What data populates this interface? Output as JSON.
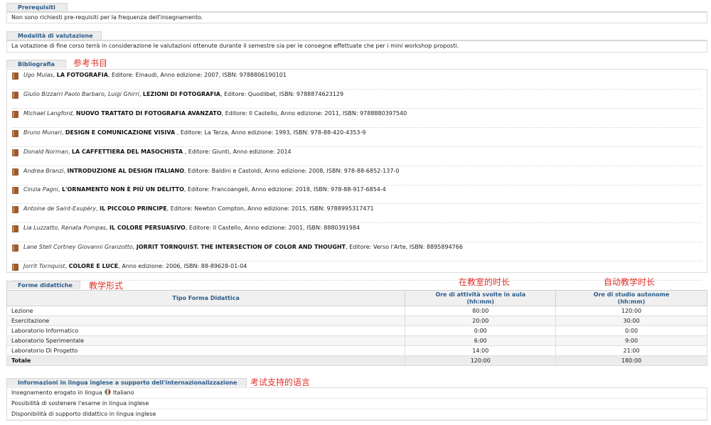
{
  "prerequisiti": {
    "tab_label": "Prerequisiti",
    "text": "Non sono richiesti pre-requisiti per la frequenza dell'insegnamento."
  },
  "valutazione": {
    "tab_label": "Modalità di valutazione",
    "text": "La votazione di fine corso terrà in considerazione le valutazioni ottenute durante il semestre sia per le consegne effettuate che per i mini workshop proposti."
  },
  "bibliografia": {
    "tab_label": "Bibliografia",
    "annotation": "参考书目",
    "items": [
      {
        "authors": "Ugo Mulas",
        "title": "LA FOTOGRAFIA",
        "details": ", Editore: Einaudi, Anno edizione: 2007, ISBN: 9788806190101"
      },
      {
        "authors": "Giulio Bizzarri Paolo Barbaro, Luigi Ghirri",
        "title": "LEZIONI DI FOTOGRAFIA",
        "details": ", Editore: Quodlibet, ISBN: 9788874623129"
      },
      {
        "authors": "Michael Langford",
        "title": "NUOVO TRATTATO DI FOTOGRAFIA AVANZATO",
        "details": ", Editore: Il Castello, Anno edizione: 2011, ISBN: 9788880397540"
      },
      {
        "authors": "Bruno Munari",
        "title": "DESIGN E COMUNICAZIONE VISIVA",
        "details": " , Editore: La Terza, Anno edizione: 1993, ISBN: 978-88-420-4353-9"
      },
      {
        "authors": "Donald Norman",
        "title": "LA CAFFETTIERA DEL MASOCHISTA",
        "details": " , Editore: Giunti, Anno edizione: 2014"
      },
      {
        "authors": "Andrea Branzi",
        "title": "INTRODUZIONE AL DESIGN ITALIANO",
        "details": ", Editore: Baldini e Castoldi, Anno edizione: 2008, ISBN: 978-88-6852-137-0"
      },
      {
        "authors": "Cinzia Pagni",
        "title": "L'ORNAMENTO NON È PIÙ UN DELITTO",
        "details": ", Editore: Francoangeli, Anno edizione: 2018, ISBN: 978-88-917-6854-4"
      },
      {
        "authors": "Antoine de Saint-Exupéry",
        "title": "IL PICCOLO PRINCIPE",
        "details": ", Editore: Newton Compton, Anno edizione: 2015, ISBN: 9788995317471"
      },
      {
        "authors": "Lia Luzzatto, Renata Pompas",
        "title": "IL COLORE PERSUASIVO",
        "details": ", Editore: Il Castello, Anno edizione: 2001, ISBN: 8880391984"
      },
      {
        "authors": "Lane Stell Cortney Giovanni Granzotto",
        "title": "JORRIT TORNQUIST. THE INTERSECTION OF COLOR AND THOUGHT",
        "details": ", Editore: Verso l'Arte, ISBN: 8895894766"
      },
      {
        "authors": "Jorrit Tornquist",
        "title": "COLORE E LUCE",
        "details": ", Anno edizione: 2006, ISBN: 88-89628-01-04"
      }
    ]
  },
  "forme_didattiche": {
    "tab_label": "Forme didattiche",
    "annotation": "教学形式",
    "annotation_aula": "在教室的时长",
    "annotation_autonomo": "自动教学时长",
    "headers": {
      "tipo": "Tipo Forma Didattica",
      "aula": "Ore di attività svolte in aula",
      "aula_unit": "(hh:mm)",
      "autonomo": "Ore di studio autonome",
      "autonomo_unit": "(hh:mm)"
    },
    "rows": [
      {
        "tipo": "Lezione",
        "aula": "80:00",
        "autonomo": "120:00"
      },
      {
        "tipo": "Esercitazione",
        "aula": "20:00",
        "autonomo": "30:00"
      },
      {
        "tipo": "Laboratorio Informatico",
        "aula": "0:00",
        "autonomo": "0:00"
      },
      {
        "tipo": "Laboratorio Sperimentale",
        "aula": "6:00",
        "autonomo": "9:00"
      },
      {
        "tipo": "Laboratorio Di Progetto",
        "aula": "14:00",
        "autonomo": "21:00"
      }
    ],
    "total": {
      "tipo": "Totale",
      "aula": "120:00",
      "autonomo": "180:00"
    }
  },
  "lingua": {
    "tab_label": "Informazioni in lingua inglese a supporto dell'internazionalizzazione",
    "annotation": "考试支持的语言",
    "rows": [
      {
        "label": "Insegnamento erogato in lingua",
        "value": "Italiano"
      },
      {
        "label": "Possibilità di sostenere l'esame in lingua inglese",
        "value": ""
      },
      {
        "label": "Disponibilità di supporto didattico in lingua inglese",
        "value": ""
      }
    ]
  },
  "colors": {
    "accent": "#2a5c8a",
    "annotation": "#e0312a",
    "book_icon": "#9c5a2f"
  }
}
